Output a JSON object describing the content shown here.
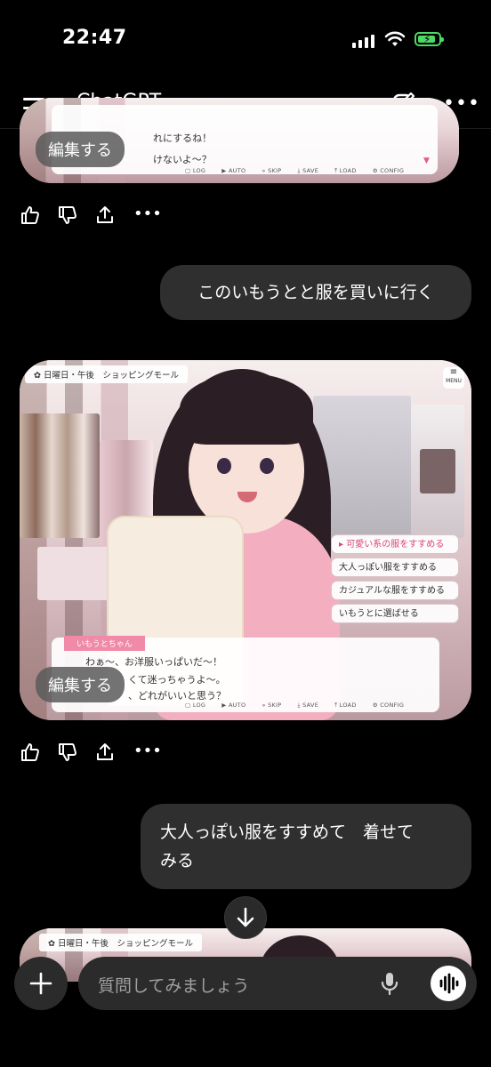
{
  "status_bar": {
    "time": "22:47"
  },
  "header": {
    "title": "ChatGPT"
  },
  "game_ui": {
    "location": "日曜日・午後　ショッピングモール",
    "menu_label": "MENU",
    "controls": [
      "LOG",
      "AUTO",
      "SKIP",
      "SAVE",
      "LOAD",
      "CONFIG"
    ]
  },
  "message1": {
    "edit_label": "編集する",
    "visible_lines": [
      "れにするね！",
      "けないよ〜？"
    ]
  },
  "user_message1": "このいもうとと服を買いに行く",
  "message2": {
    "edit_label": "編集する",
    "speaker": "いもうとちゃん",
    "lines": [
      "わぁ〜、お洋服いっぱいだ〜！",
      "くて迷っちゃうよ〜。",
      "、どれがいいと思う？"
    ],
    "choices": [
      "可愛い系の服をすすめる",
      "大人っぽい服をすすめる",
      "カジュアルな服をすすめる",
      "いもうとに選ばせる"
    ],
    "selected_choice": 0
  },
  "user_message2": {
    "line1": "大人っぽい服をすすめて　着せて",
    "line2": "みる"
  },
  "composer": {
    "placeholder": "質問してみましょう"
  },
  "colors": {
    "accent_pink": "#d8467a",
    "battery": "#4cd964",
    "bubble": "#2f2f2f"
  }
}
